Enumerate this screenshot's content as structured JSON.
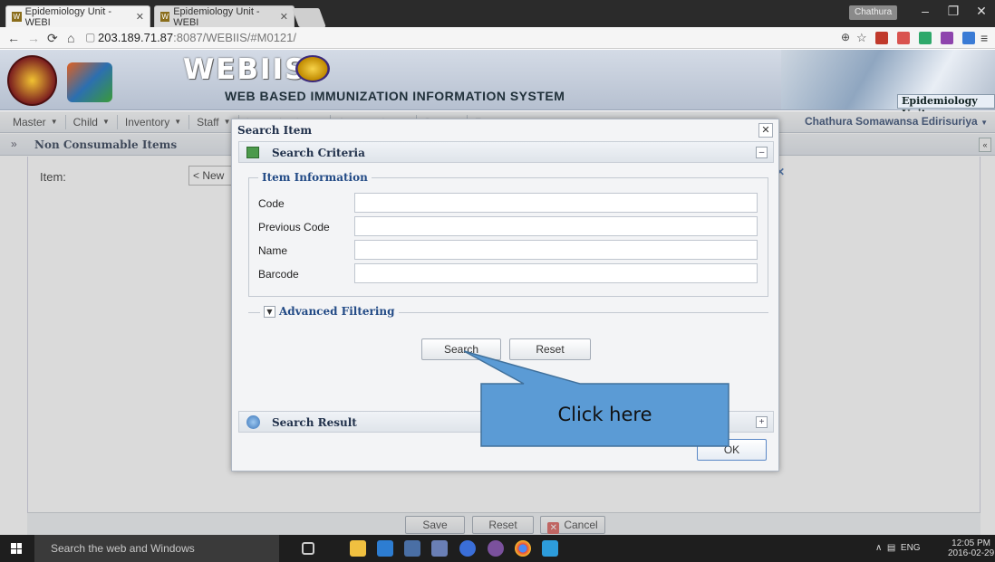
{
  "browser": {
    "tabs": [
      {
        "title": "Epidemiology Unit - WEBI",
        "active": true
      },
      {
        "title": "Epidemiology Unit - WEBI",
        "active": false
      }
    ],
    "user_chip": "Chathura",
    "url_host": "203.189.71.87",
    "url_rest": ":8087/WEBIIS/#M0121/"
  },
  "banner": {
    "brand": "WEBIIS",
    "tagline": "WEB BASED IMMUNIZATION INFORMATION SYSTEM",
    "unit": "Epidemiology Unit"
  },
  "menu": {
    "items": [
      {
        "label": "Master"
      },
      {
        "label": "Child"
      },
      {
        "label": "Inventory"
      },
      {
        "label": "Staff"
      },
      {
        "label": "Immunization"
      },
      {
        "label": "Aggregation"
      },
      {
        "label": "Sync"
      },
      {
        "label": "Reports"
      }
    ],
    "user": "Chathura Somawansa Edirisuriya"
  },
  "panel": {
    "title": "Non Consumable Items",
    "item_label": "Item:",
    "item_select": "< New",
    "footer": {
      "save": "Save",
      "reset": "Reset",
      "cancel": "Cancel"
    }
  },
  "modal": {
    "title": "Search Item",
    "criteria_header": "Search Criteria",
    "fieldset_legend": "Item Information",
    "fields": [
      {
        "label": "Code",
        "value": ""
      },
      {
        "label": "Previous Code",
        "value": ""
      },
      {
        "label": "Name",
        "value": ""
      },
      {
        "label": "Barcode",
        "value": ""
      }
    ],
    "advanced": "Advanced Filtering",
    "search_btn": "Search",
    "reset_btn": "Reset",
    "result_header": "Search Result",
    "ok_btn": "OK"
  },
  "callout": {
    "text": "Click here",
    "fill": "#5b9bd5"
  },
  "taskbar": {
    "search_placeholder": "Search the web and Windows",
    "lang": "ENG",
    "time": "12:05 PM",
    "date": "2016-02-29"
  }
}
